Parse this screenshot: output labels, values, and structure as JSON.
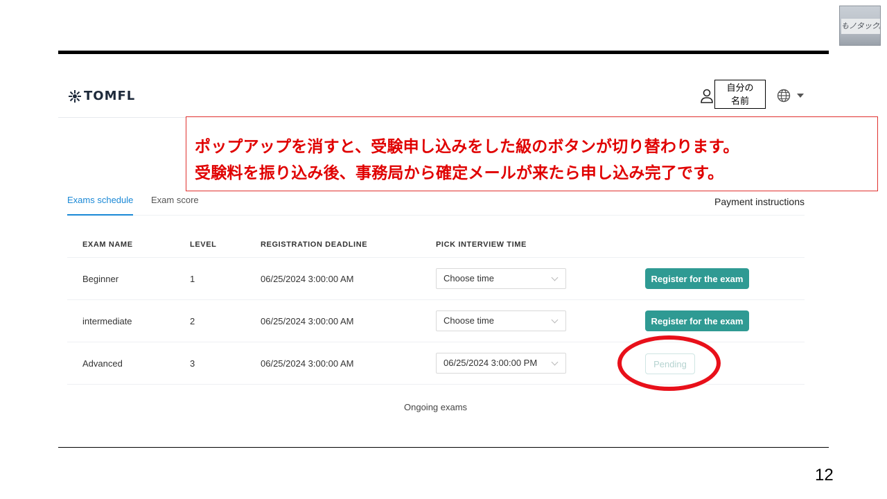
{
  "stamp": {
    "text": "もノタック。"
  },
  "header": {
    "brand": "TOMFL",
    "user_name_line1": "自分の",
    "user_name_line2": "名前"
  },
  "callout": {
    "line1": "ポップアップを消すと、受験申し込みをした級のボタンが切り替わります。",
    "line2": "受験料を振り込み後、事務局から確定メールが来たら申し込み完了です。"
  },
  "tabs": [
    {
      "label": "Exams schedule",
      "active": true
    },
    {
      "label": "Exam score",
      "active": false
    }
  ],
  "payment_instructions": "Payment instructions",
  "table": {
    "columns": [
      "EXAM NAME",
      "LEVEL",
      "REGISTRATION DEADLINE",
      "PICK INTERVIEW TIME"
    ],
    "rows": [
      {
        "name": "Beginner",
        "level": "1",
        "deadline": "06/25/2024 3:00:00 AM",
        "interview": "Choose time",
        "action": "Register for the exam"
      },
      {
        "name": "intermediate",
        "level": "2",
        "deadline": "06/25/2024 3:00:00 AM",
        "interview": "Choose time",
        "action": "Register for the exam"
      },
      {
        "name": "Advanced",
        "level": "3",
        "deadline": "06/25/2024 3:00:00 AM",
        "interview": "06/25/2024 3:00:00 PM",
        "action": "Pending"
      }
    ]
  },
  "ongoing_exams": "Ongoing exams",
  "page_number": "12",
  "colors": {
    "accent": "#2f9a93",
    "tab_active": "#1a88d6",
    "annotation_red": "#e00000"
  }
}
